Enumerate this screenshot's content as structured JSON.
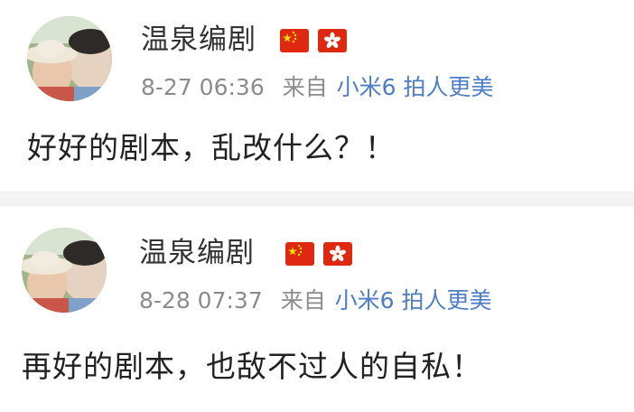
{
  "posts": [
    {
      "avatar": "avatar-photo",
      "username": "温泉编剧",
      "badges": [
        "china-flag-icon",
        "hong-kong-flag-icon"
      ],
      "timestamp": "8-27 06:36",
      "source_prefix": "来自",
      "device": "小米6 拍人更美",
      "content": "好好的剧本，乱改什么？！"
    },
    {
      "avatar": "avatar-photo",
      "username": "温泉编剧",
      "badges": [
        "china-flag-icon",
        "hong-kong-flag-icon"
      ],
      "timestamp": "8-28 07:37",
      "source_prefix": "来自",
      "device": "小米6 拍人更美",
      "content": "再好的剧本，也敌不过人的自私！"
    }
  ],
  "colors": {
    "username": "#333333",
    "meta": "#8c8c8c",
    "device_link": "#4d7ec7",
    "content": "#222222",
    "flag_red": "#de2910",
    "flag_yellow": "#ffde00"
  }
}
